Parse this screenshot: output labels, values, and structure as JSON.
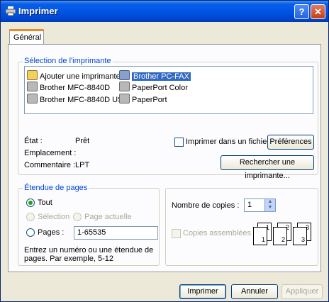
{
  "window": {
    "title": "Imprimer",
    "help": "?",
    "close": "✕"
  },
  "tabs": [
    {
      "label": "Général"
    }
  ],
  "printer_selection": {
    "legend": "Sélection de l'imprimante",
    "printers": [
      {
        "label": "Ajouter une imprimante",
        "icon": "add-printer-icon"
      },
      {
        "label": "Brother PC-FAX",
        "icon": "fax-printer-icon",
        "selected": true
      },
      {
        "label": "Brother MFC-8840D",
        "icon": "printer-icon"
      },
      {
        "label": "PaperPort Color",
        "icon": "printer-icon"
      },
      {
        "label": "Brother MFC-8840D USB",
        "icon": "printer-icon"
      },
      {
        "label": "PaperPort",
        "icon": "printer-icon"
      }
    ]
  },
  "status": {
    "state_label": "État :",
    "state_value": "Prêt",
    "location_label": "Emplacement :",
    "comment_label": "Commentaire :",
    "comment_value": "LPT",
    "print_to_file": "Imprimer dans un fichier",
    "preferences": "Préférences",
    "find_printer": "Rechercher une imprimante..."
  },
  "page_range": {
    "legend": "Étendue de pages",
    "all": "Tout",
    "selection": "Sélection",
    "current_page": "Page actuelle",
    "pages": "Pages :",
    "pages_value": "1-65535",
    "hint": "Entrez un numéro ou une étendue de pages. Par exemple, 5-12"
  },
  "copies": {
    "label": "Nombre de copies :",
    "value": "1",
    "collate": "Copies assemblées",
    "collate_pages": [
      "1",
      "1",
      "2",
      "2",
      "3",
      "3"
    ]
  },
  "buttons": {
    "print": "Imprimer",
    "cancel": "Annuler",
    "apply": "Appliquer"
  },
  "colors": {
    "title_bar": "#0055e5",
    "accent_tab": "#e68b2c",
    "legend": "#0046d5",
    "selection": "#316ac5"
  }
}
